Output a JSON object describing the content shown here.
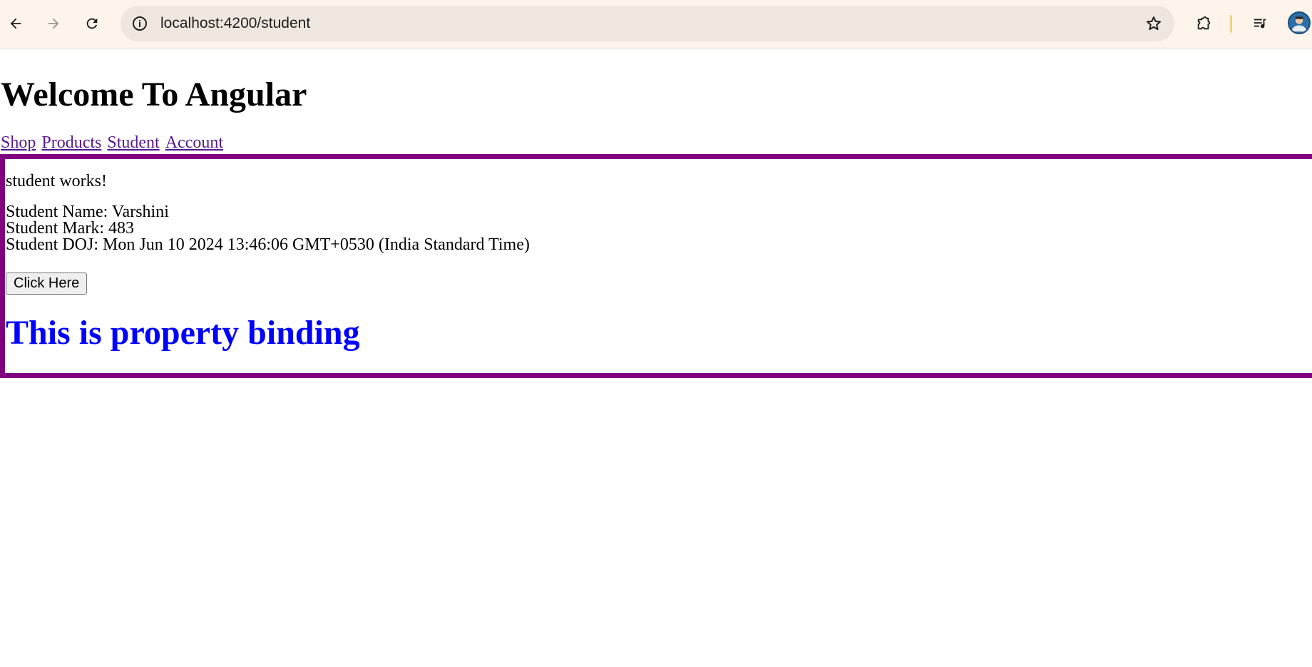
{
  "browser": {
    "url": "localhost:4200/student"
  },
  "page": {
    "title": "Welcome To Angular",
    "nav": [
      "Shop",
      "Products",
      "Student",
      "Account"
    ],
    "component": {
      "works_text": "student works!",
      "student_name": "Student Name: Varshini",
      "student_mark": "Student Mark: 483",
      "student_doj": "Student DOJ: Mon Jun 10 2024 13:46:06 GMT+0530 (India Standard Time)",
      "button_label": "Click Here",
      "property_binding_text": "This is property binding"
    }
  },
  "colors": {
    "chrome_bg": "#fdf5ec",
    "omnibox_bg": "#efe7df",
    "border": "#800080",
    "link": "#551a8b",
    "binding_text": "#0000ff"
  },
  "icons": [
    "back-icon",
    "forward-icon",
    "reload-icon",
    "site-info-icon",
    "bookmark-star-icon",
    "extensions-icon",
    "reading-list-icon",
    "profile-avatar-icon"
  ]
}
